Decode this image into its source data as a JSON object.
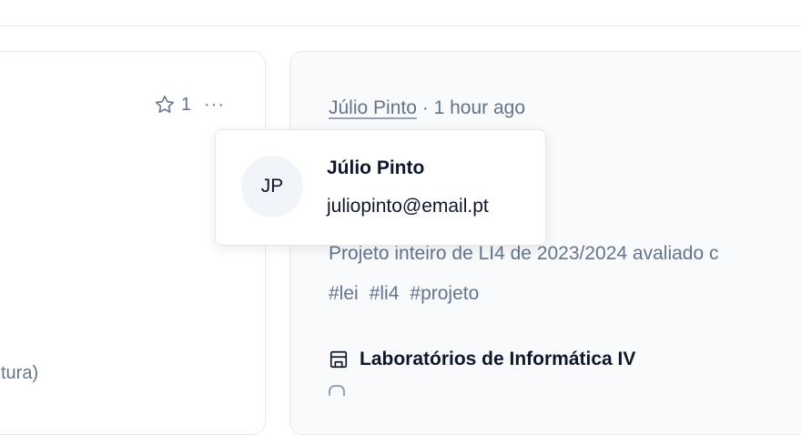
{
  "left_card": {
    "star_count": "1",
    "more_label": "···",
    "snippet": "tura)"
  },
  "post": {
    "author": "Júlio Pinto",
    "separator": "·",
    "time": "1 hour ago",
    "description": "Projeto inteiro de LI4 de 2023/2024 avaliado c",
    "tags": [
      "#lei",
      "#li4",
      "#projeto"
    ],
    "course": "Laboratórios de Informática IV"
  },
  "popover": {
    "initials": "JP",
    "name": "Júlio Pinto",
    "email": "juliopinto@email.pt"
  },
  "colors": {
    "muted_text": "#64748b",
    "border": "#e5e7eb",
    "avatar_bg": "#f1f5f9"
  }
}
